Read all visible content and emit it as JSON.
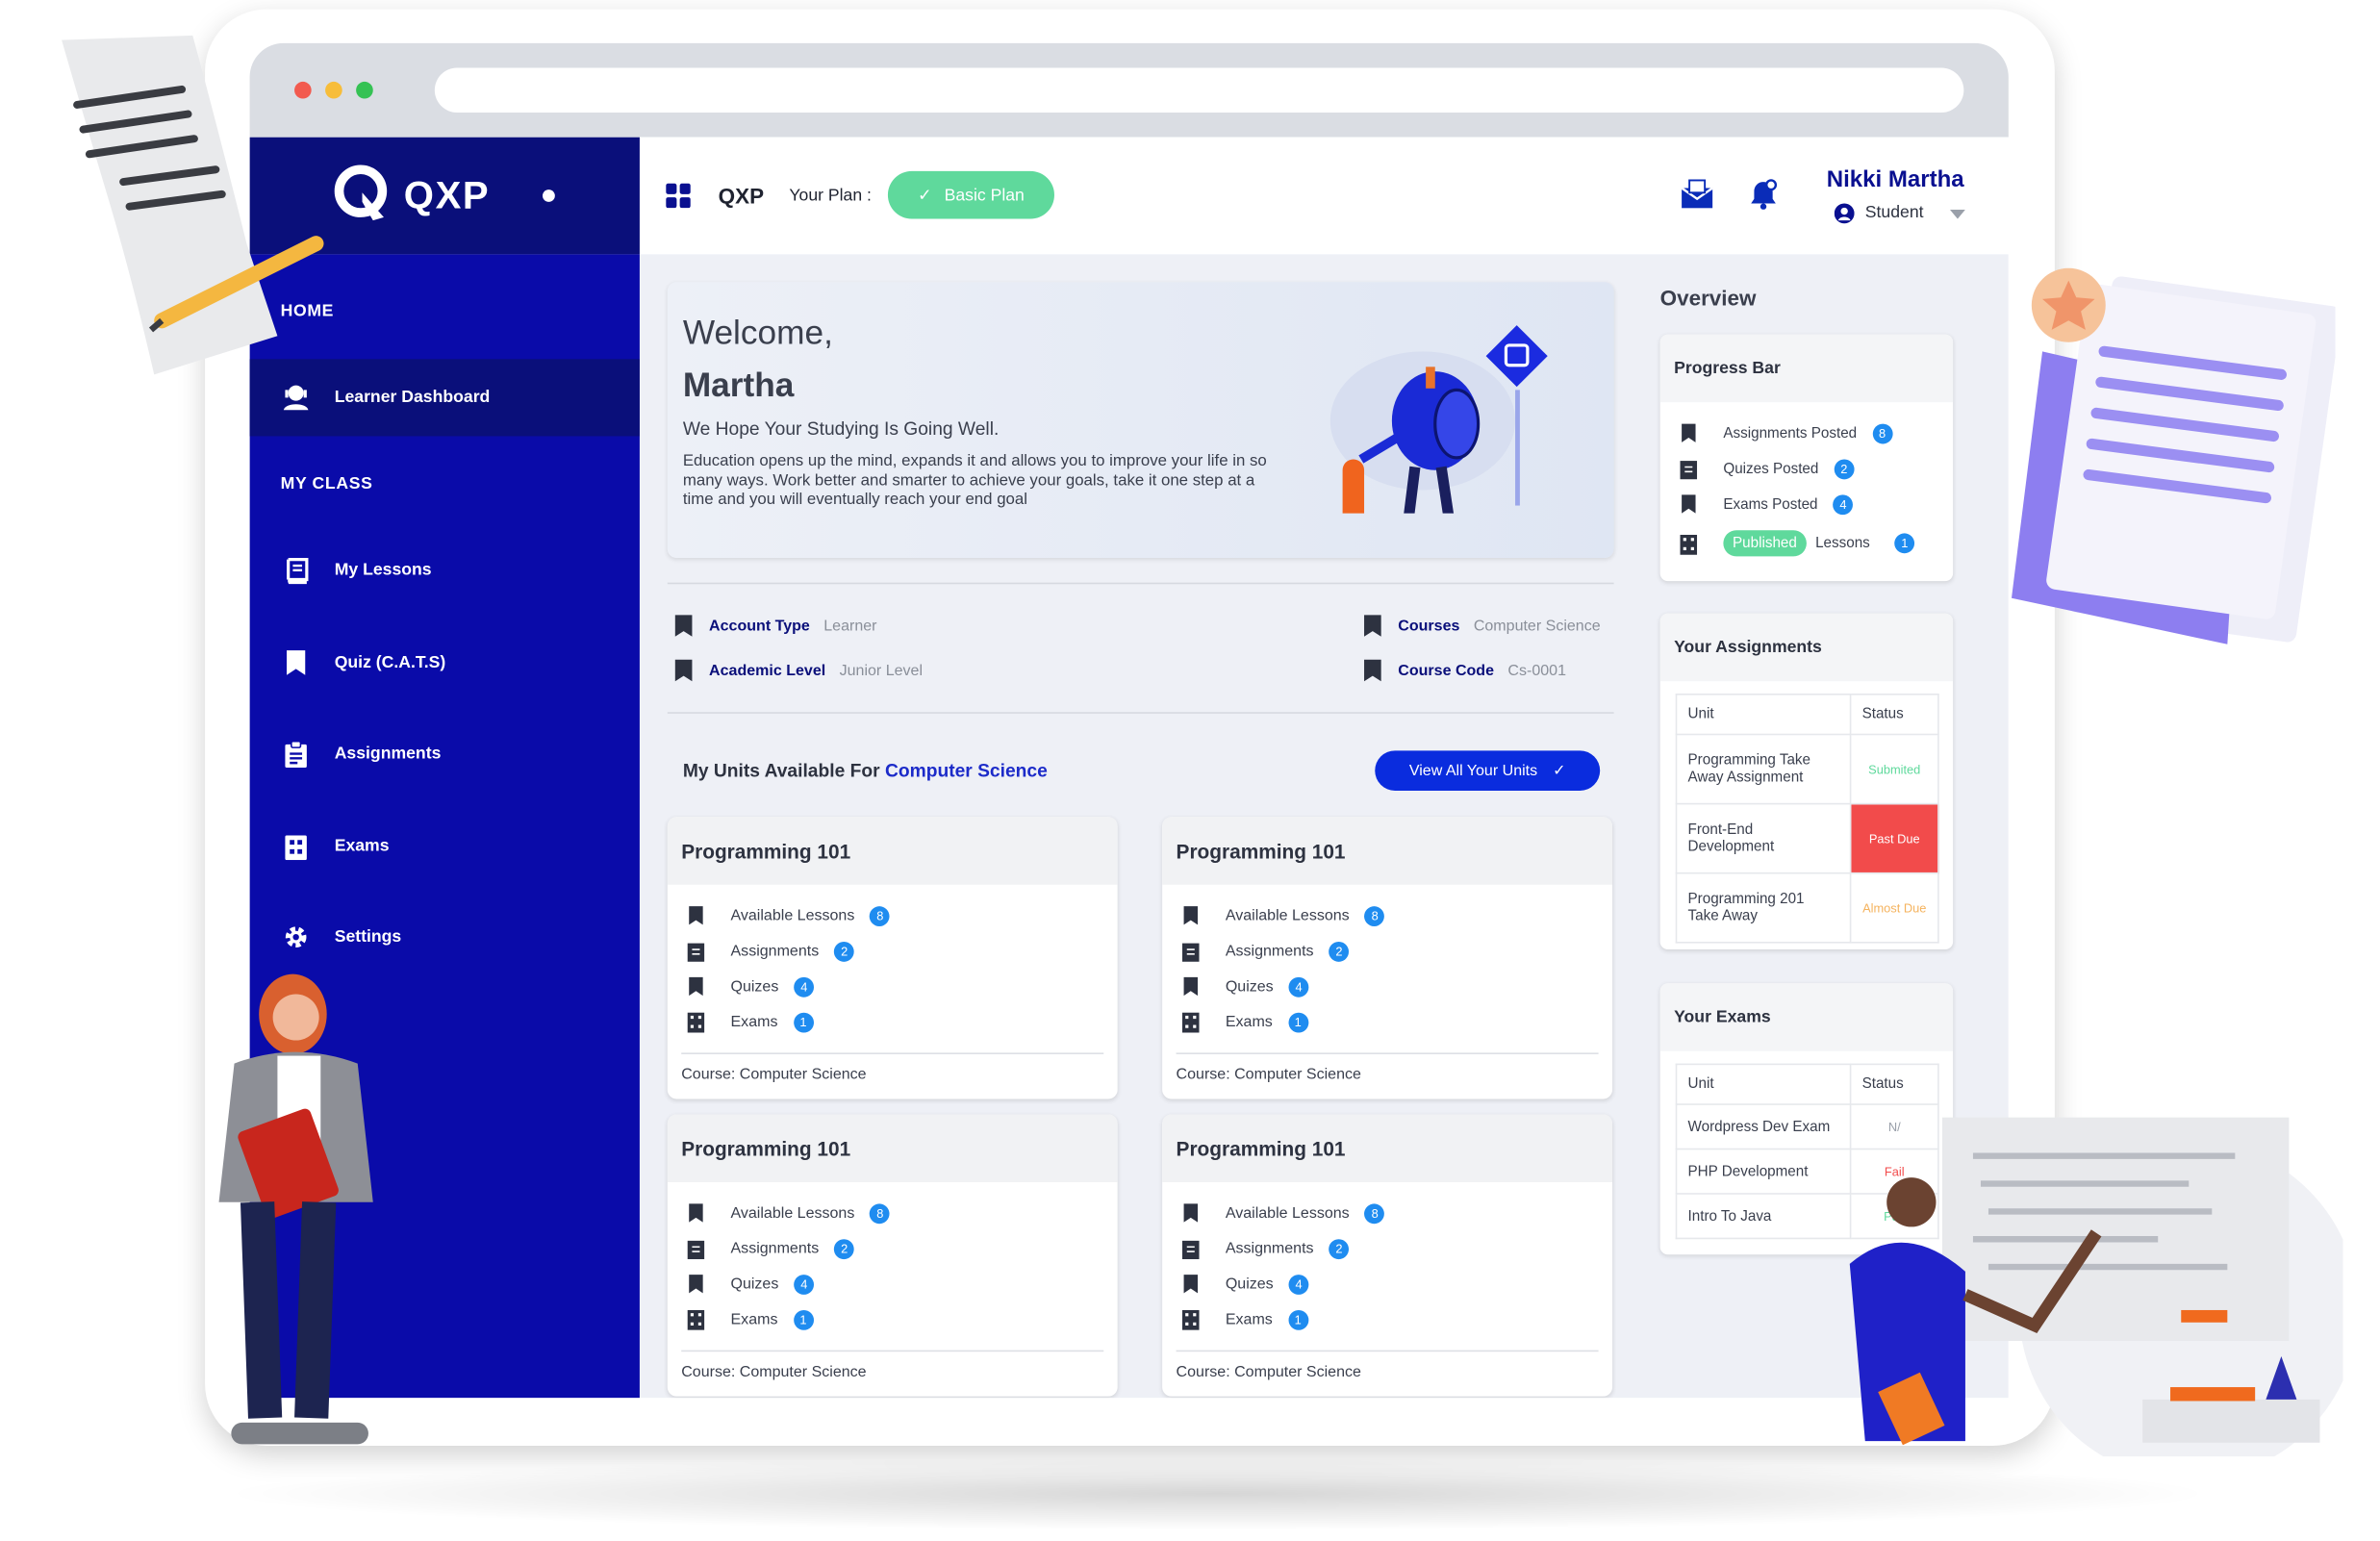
{
  "app": {
    "brand": "QXP"
  },
  "topbar": {
    "brand": "QXP",
    "plan_label": "Your Plan :",
    "plan_value": "Basic Plan",
    "user_name": "Nikki Martha",
    "user_role": "Student"
  },
  "sidebar": {
    "sections": [
      "HOME",
      "MY CLASS"
    ],
    "items": [
      {
        "label": "Learner Dashboard",
        "icon": "learner-icon"
      },
      {
        "label": "My Lessons",
        "icon": "book-icon"
      },
      {
        "label": "Quiz (C.A.T.S)",
        "icon": "bookmark-icon"
      },
      {
        "label": "Assignments",
        "icon": "clipboard-icon"
      },
      {
        "label": "Exams",
        "icon": "exam-icon"
      },
      {
        "label": "Settings",
        "icon": "gear-icon"
      }
    ]
  },
  "welcome": {
    "line1": "Welcome,",
    "name": "Martha",
    "subtitle": "We Hope Your Studying Is Going Well.",
    "body": "Education opens up the mind, expands it and allows you to improve your life in so many ways. Work better and smarter to achieve your goals, take it one step at a time and you will eventually reach your end goal"
  },
  "profile": {
    "account_type_label": "Account Type",
    "account_type": "Learner",
    "academic_level_label": "Academic Level",
    "academic_level": "Junior Level",
    "courses_label": "Courses",
    "courses": "Computer Science",
    "course_code_label": "Course Code",
    "course_code": "Cs-0001"
  },
  "units": {
    "title": "My Units Available For",
    "course": "Computer Science",
    "view_all": "View All Your Units",
    "cards": [
      {
        "title": "Programming 101",
        "lessons_label": "Available Lessons",
        "lessons": "8",
        "assignments_label": "Assignments",
        "assignments": "2",
        "quizzes_label": "Quizes",
        "quizzes": "4",
        "exams_label": "Exams",
        "exams": "1",
        "footer": "Course: Computer Science"
      },
      {
        "title": "Programming 101",
        "lessons_label": "Available Lessons",
        "lessons": "8",
        "assignments_label": "Assignments",
        "assignments": "2",
        "quizzes_label": "Quizes",
        "quizzes": "4",
        "exams_label": "Exams",
        "exams": "1",
        "footer": "Course: Computer Science"
      },
      {
        "title": "Programming 101",
        "lessons_label": "Available Lessons",
        "lessons": "8",
        "assignments_label": "Assignments",
        "assignments": "2",
        "quizzes_label": "Quizes",
        "quizzes": "4",
        "exams_label": "Exams",
        "exams": "1",
        "footer": "Course: Computer Science"
      },
      {
        "title": "Programming 101",
        "lessons_label": "Available Lessons",
        "lessons": "8",
        "assignments_label": "Assignments",
        "assignments": "2",
        "quizzes_label": "Quizes",
        "quizzes": "4",
        "exams_label": "Exams",
        "exams": "1",
        "footer": "Course: Computer Science"
      }
    ]
  },
  "overview": {
    "title": "Overview",
    "progress": {
      "title": "Progress Bar",
      "rows": [
        {
          "label": "Assignments Posted",
          "value": "8"
        },
        {
          "label": "Quizes Posted",
          "value": "2"
        },
        {
          "label": "Exams Posted",
          "value": "4"
        }
      ],
      "published_pill": "Published",
      "lessons_label": "Lessons",
      "lessons_value": "1"
    },
    "assignments": {
      "title": "Your Assignments",
      "col_unit": "Unit",
      "col_status": "Status",
      "rows": [
        {
          "unit": "Programming Take Away Assignment",
          "status": "Submited",
          "color": "#5fd99c"
        },
        {
          "unit": "Front-End Development",
          "status": "Past Due",
          "color": "#f24b4b"
        },
        {
          "unit": "Programming 201 Take Away",
          "status": "Almost Due",
          "color": "#f5b35e"
        }
      ]
    },
    "exams": {
      "title": "Your Exams",
      "col_unit": "Unit",
      "col_status": "Status",
      "rows": [
        {
          "unit": "Wordpress Dev Exam",
          "status": "N/"
        },
        {
          "unit": "PHP Development",
          "status": "Fail"
        },
        {
          "unit": "Intro To Java",
          "status": "Pas"
        }
      ]
    }
  },
  "colors": {
    "sidebar": "#0a0ba9",
    "brand_dark": "#0a0f7a",
    "accent": "#0a2cde",
    "badge": "#1f8cf0",
    "success": "#5fd99c",
    "danger": "#f24b4b"
  }
}
